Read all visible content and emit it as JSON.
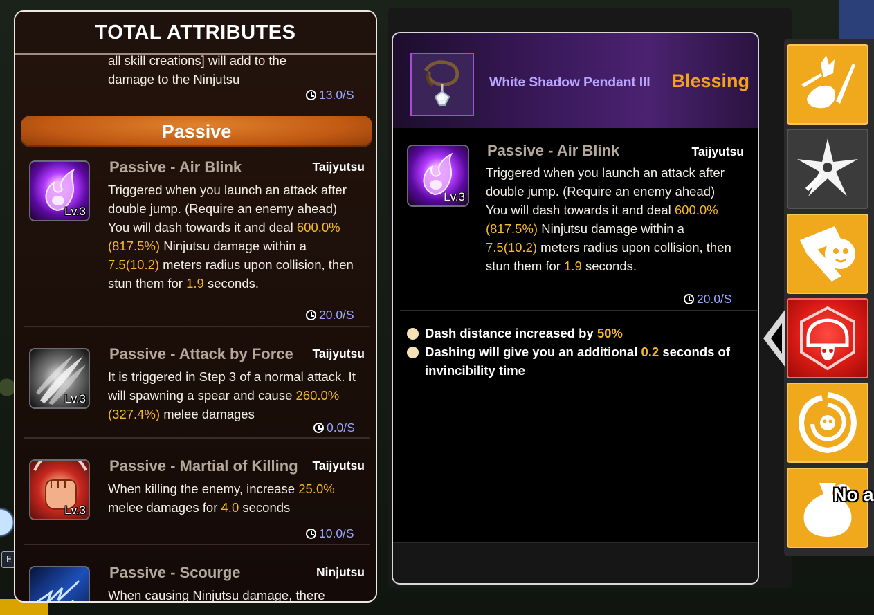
{
  "left_panel": {
    "title": "TOTAL ATTRIBUTES",
    "top_fragment": {
      "line1": "all skill creations] will add to the",
      "line2": "damage to the Ninjutsu",
      "cooldown": "13.0/S"
    },
    "section_label": "Passive",
    "skills": [
      {
        "name": "Passive - Air Blink",
        "type": "Taijyutsu",
        "level": "Lv.3",
        "icon": "air-blink-icon",
        "desc_parts": [
          "Triggered when you launch an attack after double jump. (Require an enemy ahead) You will dash towards it and deal ",
          "600.0%(817.5%)",
          " Ninjutsu damage within a ",
          "7.5(10.2)",
          " meters radius upon collision, then stun them for ",
          "1.9",
          " seconds."
        ],
        "cooldown": "20.0/S"
      },
      {
        "name": "Passive - Attack by Force",
        "type": "Taijyutsu",
        "level": "Lv.3",
        "icon": "attack-by-force-icon",
        "desc_parts": [
          "It is triggered in Step 3 of a normal attack. It will spawning a spear and cause ",
          "260.0%(327.4%)",
          " melee damages"
        ],
        "cooldown": "0.0/S"
      },
      {
        "name": "Passive - Martial of Killing",
        "type": "Taijyutsu",
        "level": "Lv.3",
        "icon": "martial-of-killing-icon",
        "desc_parts": [
          "When killing the enemy, increase ",
          "25.0%",
          " melee damages for ",
          "4.0",
          " seconds"
        ],
        "cooldown": "10.0/S"
      },
      {
        "name": "Passive - Scourge",
        "type": "Ninjutsu",
        "level": "",
        "icon": "scourge-icon",
        "desc_parts": [
          "When causing Ninjutsu damage, there"
        ],
        "cooldown": ""
      }
    ]
  },
  "item_card": {
    "name": "White Shadow Pendant III",
    "rarity": "Blessing",
    "icon": "pendant-icon",
    "skill": {
      "name": "Passive - Air Blink",
      "type": "Taijyutsu",
      "level": "Lv.3",
      "desc_parts": [
        "Triggered when you launch an attack after double jump. (Require an enemy ahead) You will dash towards it and deal ",
        "600.0%(817.5%)",
        " Ninjutsu damage within a ",
        "7.5(10.2)",
        " meters radius upon collision, then stun them for ",
        "1.9",
        " seconds."
      ],
      "cooldown": "20.0/S"
    },
    "bullets": [
      {
        "parts": [
          "Dash distance increased by ",
          "50%",
          ""
        ]
      },
      {
        "parts": [
          "Dashing will give you an additional ",
          "0.2",
          " seconds of invincibility time"
        ]
      }
    ]
  },
  "side_tabs": [
    {
      "icon": "weapons-bag-icon",
      "state": "gold"
    },
    {
      "icon": "shuriken-icon",
      "state": "dark"
    },
    {
      "icon": "scroll-mask-icon",
      "state": "gold"
    },
    {
      "icon": "skull-helmet-icon",
      "state": "selected"
    },
    {
      "icon": "skull-vortex-icon",
      "state": "gold"
    },
    {
      "icon": "money-bag-icon",
      "state": "gold"
    }
  ],
  "overlay_text": "No a",
  "background": {
    "key_hint": "E"
  },
  "colors": {
    "highlight": "#f5b829",
    "cooldown": "#9aa6ff",
    "rarity": "#f5a21a",
    "item_name": "#b8a6ff",
    "passive_banner": "#c15a14"
  }
}
